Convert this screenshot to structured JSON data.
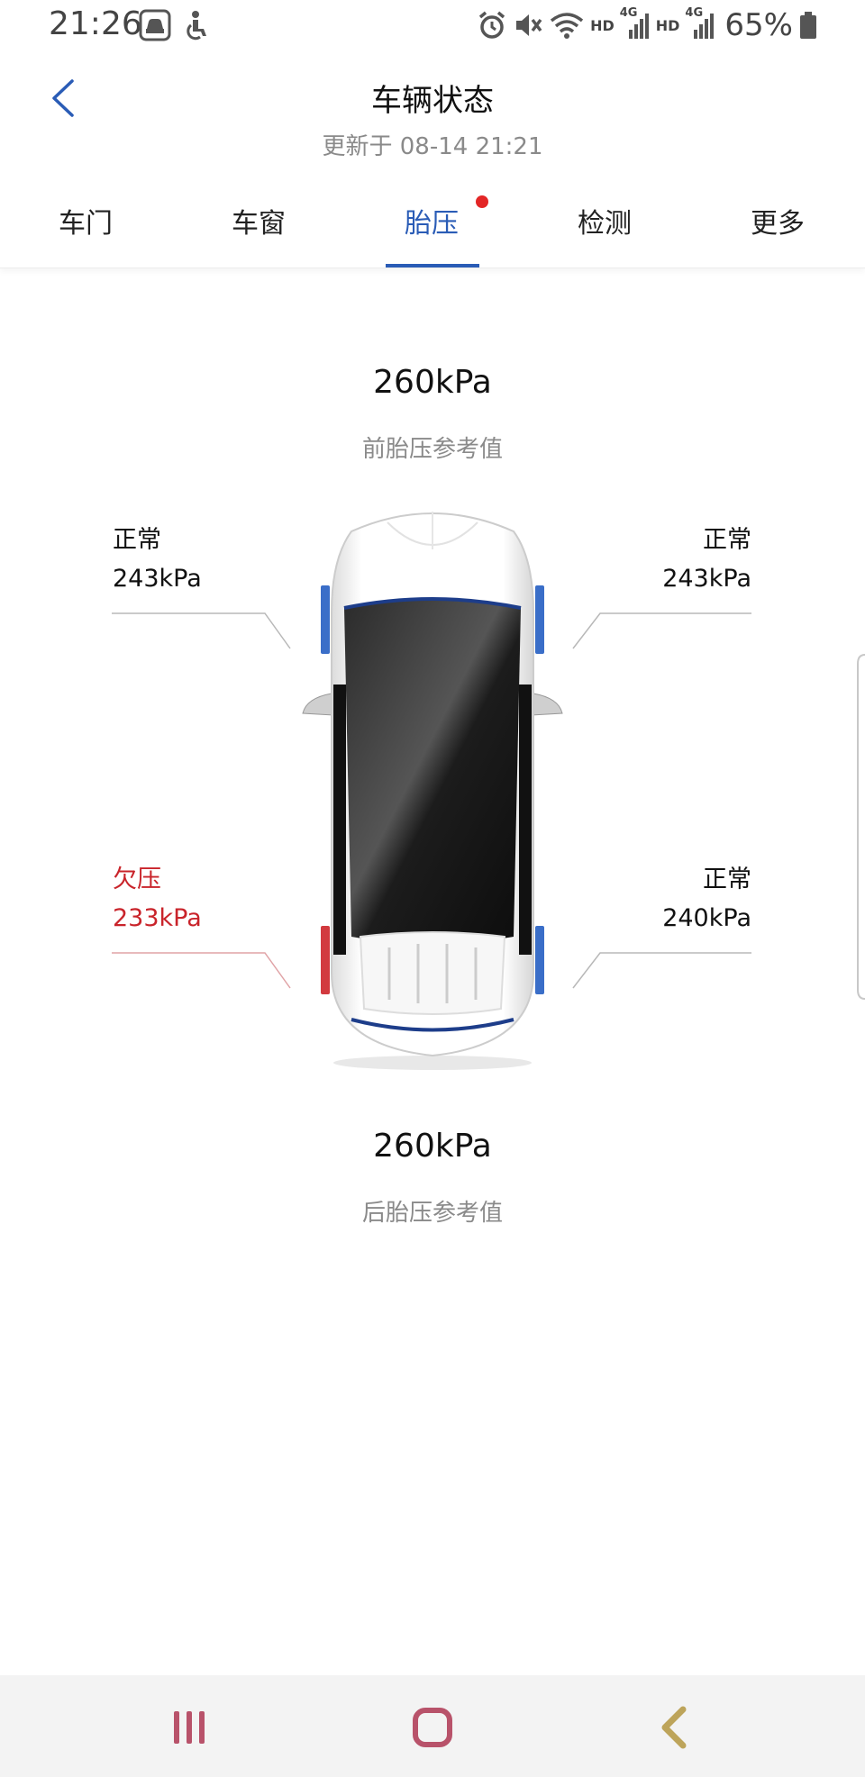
{
  "status_bar": {
    "time": "21:26",
    "net1": "HD",
    "net1_gen": "4G",
    "net2": "HD",
    "net2_gen": "4G",
    "battery": "65%",
    "icons": [
      "car-mode-icon",
      "accessibility-icon",
      "alarm-icon",
      "mute-icon",
      "wifi-icon",
      "signal-icon",
      "battery-icon"
    ]
  },
  "header": {
    "title": "车辆状态",
    "subtitle": "更新于 08-14 21:21"
  },
  "tabs": [
    {
      "label": "车门"
    },
    {
      "label": "车窗"
    },
    {
      "label": "胎压",
      "active": true,
      "badge": true
    },
    {
      "label": "检测"
    },
    {
      "label": "更多"
    }
  ],
  "tire_pressure": {
    "front_reference": {
      "value": "260kPa",
      "label": "前胎压参考值"
    },
    "rear_reference": {
      "value": "260kPa",
      "label": "后胎压参考值"
    },
    "front_left": {
      "status": "正常",
      "value": "243kPa"
    },
    "front_right": {
      "status": "正常",
      "value": "243kPa"
    },
    "rear_left": {
      "status": "欠压",
      "value": "233kPa"
    },
    "rear_right": {
      "status": "正常",
      "value": "240kPa"
    }
  },
  "colors": {
    "accent": "#2a5cb6",
    "warning": "#c9242b",
    "badge": "#e32626",
    "normal_tire": "#3a6ec8"
  }
}
